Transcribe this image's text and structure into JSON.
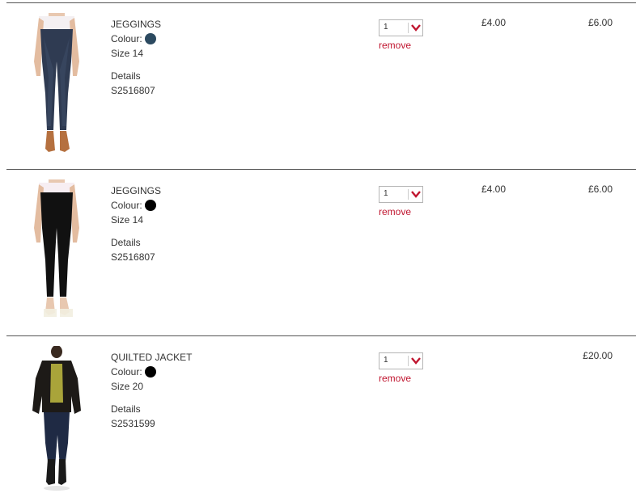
{
  "basket": {
    "items": [
      {
        "name": "JEGGINGS",
        "colour_label": "Colour:",
        "colour_hex": "#2c4a60",
        "size": "Size 14",
        "details_label": "Details",
        "sku": "S2516807",
        "quantity": "1",
        "remove_label": "remove",
        "unit_price": "£4.00",
        "total_price": "£6.00",
        "image_icon": "jeggings-indigo-product-image"
      },
      {
        "name": "JEGGINGS",
        "colour_label": "Colour:",
        "colour_hex": "#000000",
        "size": "Size 14",
        "details_label": "Details",
        "sku": "S2516807",
        "quantity": "1",
        "remove_label": "remove",
        "unit_price": "£4.00",
        "total_price": "£6.00",
        "image_icon": "jeggings-black-product-image"
      },
      {
        "name": "QUILTED JACKET",
        "colour_label": "Colour:",
        "colour_hex": "#000000",
        "size": "Size 20",
        "details_label": "Details",
        "sku": "S2531599",
        "quantity": "1",
        "remove_label": "remove",
        "unit_price": "",
        "total_price": "£20.00",
        "image_icon": "quilted-jacket-product-image"
      }
    ]
  },
  "colors": {
    "accent": "#c0152f",
    "rule": "#555555",
    "text": "#333333"
  }
}
